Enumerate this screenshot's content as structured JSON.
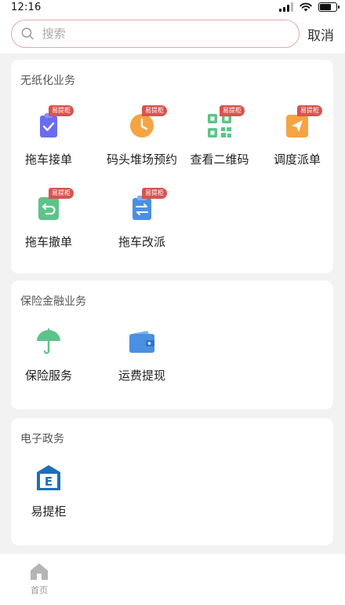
{
  "status_bar": {
    "time": "12:16"
  },
  "search": {
    "placeholder": "搜索",
    "cancel_label": "取消"
  },
  "sections": [
    {
      "title": "无纸化业务",
      "items": [
        {
          "label": "拖车接单",
          "icon": "clipboard-check-icon",
          "badge": "易提柜",
          "color": "#6a6cf0"
        },
        {
          "label": "码头堆场预约",
          "icon": "clock-icon",
          "badge": "易提柜",
          "color": "#f5a442"
        },
        {
          "label": "查看二维码",
          "icon": "qr-code-icon",
          "badge": "易提柜",
          "color": "#5cc488"
        },
        {
          "label": "调度派单",
          "icon": "send-icon",
          "badge": "易提柜",
          "color": "#f5a442"
        },
        {
          "label": "拖车撤单",
          "icon": "undo-icon",
          "badge": "易提柜",
          "color": "#5cc488"
        },
        {
          "label": "拖车改派",
          "icon": "swap-icon",
          "badge": "易提柜",
          "color": "#4a90e2"
        }
      ]
    },
    {
      "title": "保险金融业务",
      "items": [
        {
          "label": "保险服务",
          "icon": "umbrella-icon",
          "color": "#5cc488"
        },
        {
          "label": "运费提现",
          "icon": "wallet-icon",
          "color": "#4a90e2"
        }
      ]
    },
    {
      "title": "电子政务",
      "items": [
        {
          "label": "易提柜",
          "icon": "e-cabinet-icon",
          "color": "#1f6fb5"
        }
      ]
    }
  ],
  "tab_bar": {
    "home_label": "首页"
  }
}
